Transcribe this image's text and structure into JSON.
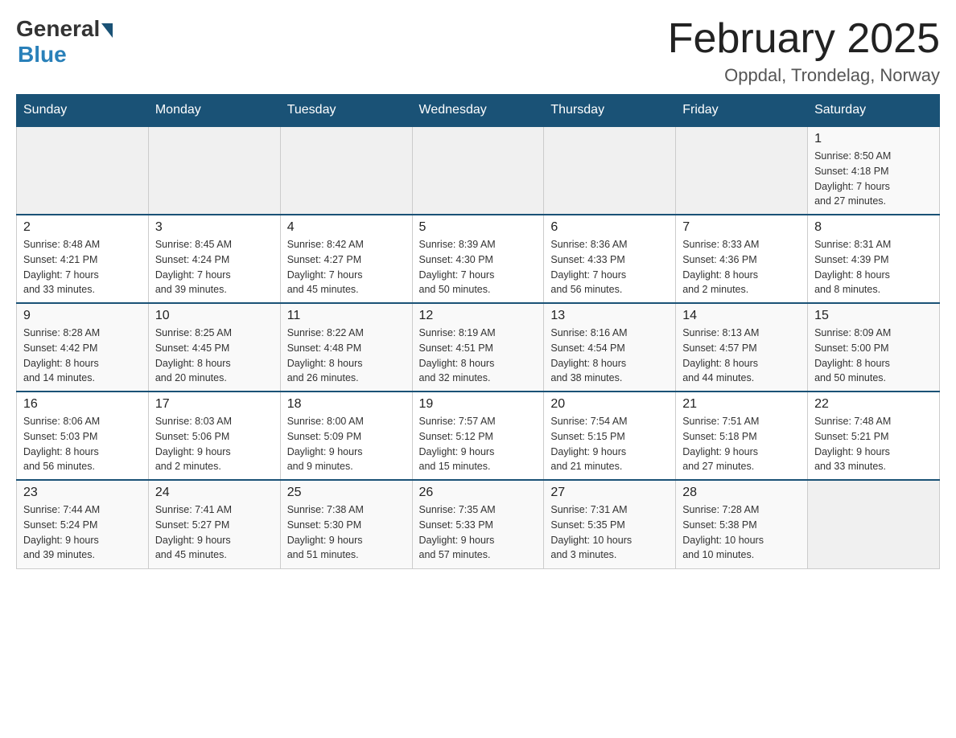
{
  "logo": {
    "general": "General",
    "blue": "Blue"
  },
  "title": {
    "month": "February 2025",
    "location": "Oppdal, Trondelag, Norway"
  },
  "days_of_week": [
    "Sunday",
    "Monday",
    "Tuesday",
    "Wednesday",
    "Thursday",
    "Friday",
    "Saturday"
  ],
  "weeks": [
    [
      {
        "day": "",
        "info": ""
      },
      {
        "day": "",
        "info": ""
      },
      {
        "day": "",
        "info": ""
      },
      {
        "day": "",
        "info": ""
      },
      {
        "day": "",
        "info": ""
      },
      {
        "day": "",
        "info": ""
      },
      {
        "day": "1",
        "info": "Sunrise: 8:50 AM\nSunset: 4:18 PM\nDaylight: 7 hours\nand 27 minutes."
      }
    ],
    [
      {
        "day": "2",
        "info": "Sunrise: 8:48 AM\nSunset: 4:21 PM\nDaylight: 7 hours\nand 33 minutes."
      },
      {
        "day": "3",
        "info": "Sunrise: 8:45 AM\nSunset: 4:24 PM\nDaylight: 7 hours\nand 39 minutes."
      },
      {
        "day": "4",
        "info": "Sunrise: 8:42 AM\nSunset: 4:27 PM\nDaylight: 7 hours\nand 45 minutes."
      },
      {
        "day": "5",
        "info": "Sunrise: 8:39 AM\nSunset: 4:30 PM\nDaylight: 7 hours\nand 50 minutes."
      },
      {
        "day": "6",
        "info": "Sunrise: 8:36 AM\nSunset: 4:33 PM\nDaylight: 7 hours\nand 56 minutes."
      },
      {
        "day": "7",
        "info": "Sunrise: 8:33 AM\nSunset: 4:36 PM\nDaylight: 8 hours\nand 2 minutes."
      },
      {
        "day": "8",
        "info": "Sunrise: 8:31 AM\nSunset: 4:39 PM\nDaylight: 8 hours\nand 8 minutes."
      }
    ],
    [
      {
        "day": "9",
        "info": "Sunrise: 8:28 AM\nSunset: 4:42 PM\nDaylight: 8 hours\nand 14 minutes."
      },
      {
        "day": "10",
        "info": "Sunrise: 8:25 AM\nSunset: 4:45 PM\nDaylight: 8 hours\nand 20 minutes."
      },
      {
        "day": "11",
        "info": "Sunrise: 8:22 AM\nSunset: 4:48 PM\nDaylight: 8 hours\nand 26 minutes."
      },
      {
        "day": "12",
        "info": "Sunrise: 8:19 AM\nSunset: 4:51 PM\nDaylight: 8 hours\nand 32 minutes."
      },
      {
        "day": "13",
        "info": "Sunrise: 8:16 AM\nSunset: 4:54 PM\nDaylight: 8 hours\nand 38 minutes."
      },
      {
        "day": "14",
        "info": "Sunrise: 8:13 AM\nSunset: 4:57 PM\nDaylight: 8 hours\nand 44 minutes."
      },
      {
        "day": "15",
        "info": "Sunrise: 8:09 AM\nSunset: 5:00 PM\nDaylight: 8 hours\nand 50 minutes."
      }
    ],
    [
      {
        "day": "16",
        "info": "Sunrise: 8:06 AM\nSunset: 5:03 PM\nDaylight: 8 hours\nand 56 minutes."
      },
      {
        "day": "17",
        "info": "Sunrise: 8:03 AM\nSunset: 5:06 PM\nDaylight: 9 hours\nand 2 minutes."
      },
      {
        "day": "18",
        "info": "Sunrise: 8:00 AM\nSunset: 5:09 PM\nDaylight: 9 hours\nand 9 minutes."
      },
      {
        "day": "19",
        "info": "Sunrise: 7:57 AM\nSunset: 5:12 PM\nDaylight: 9 hours\nand 15 minutes."
      },
      {
        "day": "20",
        "info": "Sunrise: 7:54 AM\nSunset: 5:15 PM\nDaylight: 9 hours\nand 21 minutes."
      },
      {
        "day": "21",
        "info": "Sunrise: 7:51 AM\nSunset: 5:18 PM\nDaylight: 9 hours\nand 27 minutes."
      },
      {
        "day": "22",
        "info": "Sunrise: 7:48 AM\nSunset: 5:21 PM\nDaylight: 9 hours\nand 33 minutes."
      }
    ],
    [
      {
        "day": "23",
        "info": "Sunrise: 7:44 AM\nSunset: 5:24 PM\nDaylight: 9 hours\nand 39 minutes."
      },
      {
        "day": "24",
        "info": "Sunrise: 7:41 AM\nSunset: 5:27 PM\nDaylight: 9 hours\nand 45 minutes."
      },
      {
        "day": "25",
        "info": "Sunrise: 7:38 AM\nSunset: 5:30 PM\nDaylight: 9 hours\nand 51 minutes."
      },
      {
        "day": "26",
        "info": "Sunrise: 7:35 AM\nSunset: 5:33 PM\nDaylight: 9 hours\nand 57 minutes."
      },
      {
        "day": "27",
        "info": "Sunrise: 7:31 AM\nSunset: 5:35 PM\nDaylight: 10 hours\nand 3 minutes."
      },
      {
        "day": "28",
        "info": "Sunrise: 7:28 AM\nSunset: 5:38 PM\nDaylight: 10 hours\nand 10 minutes."
      },
      {
        "day": "",
        "info": ""
      }
    ]
  ]
}
